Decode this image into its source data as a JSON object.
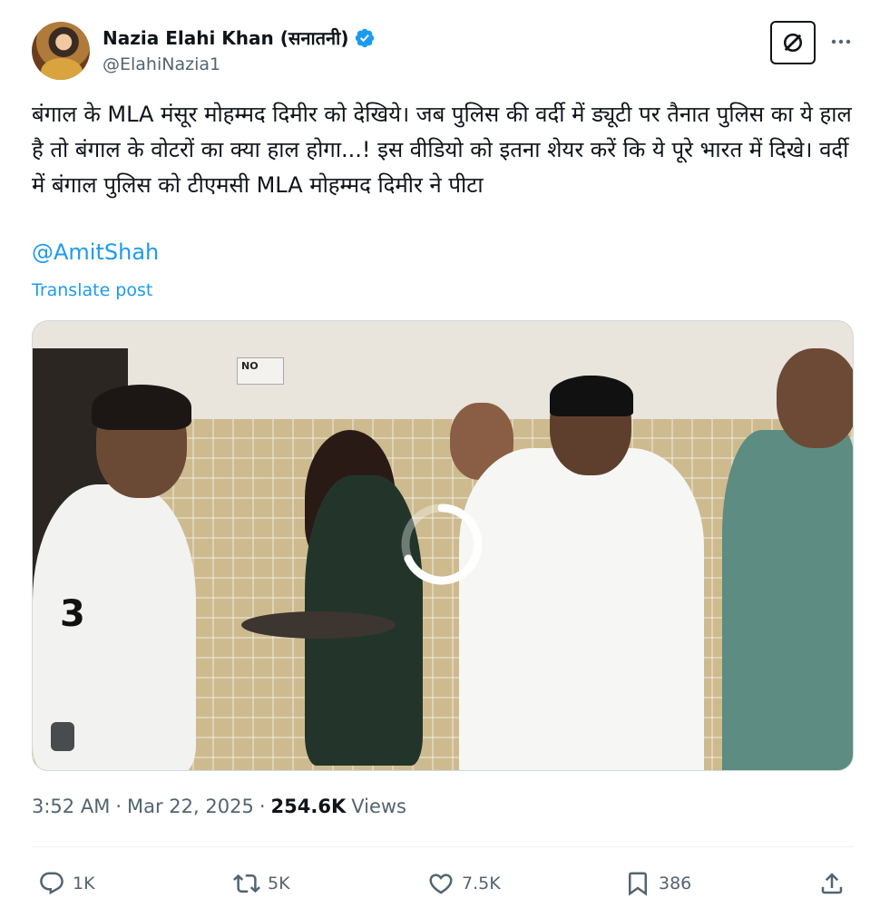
{
  "author": {
    "display_name": "Nazia Elahi Khan (सनातनी)",
    "handle": "@ElahiNazia1",
    "verified_color": "#1d9bf0"
  },
  "post": {
    "text": "बंगाल के MLA मंसूर मोहम्मद दिमीर को देखिये। जब पुलिस की वर्दी में ड्यूटी पर तैनात पुलिस का ये हाल है तो बंगाल के वोटरों का क्या हाल होगा...! इस वीडियो को इतना शेयर करें कि ये पूरे भारत में दिखे। वर्दी में बंगाल पुलिस को टीएमसी MLA मोहम्मद दिमीर ने पीटा",
    "mention": "@AmitShah",
    "translate_label": "Translate post",
    "media_sign_text": "NO",
    "jersey_number": "3"
  },
  "meta": {
    "time": "3:52 AM",
    "separator": "·",
    "date": "Mar 22, 2025",
    "views_count": "254.6K",
    "views_label": "Views"
  },
  "actions": {
    "replies": "1K",
    "reposts": "5K",
    "likes": "7.5K",
    "bookmarks": "386"
  },
  "icons": {
    "grok": "grok-icon",
    "more": "more-icon",
    "reply": "reply-icon",
    "repost": "repost-icon",
    "like": "heart-icon",
    "bookmark": "bookmark-icon",
    "share": "share-icon",
    "verified": "verified-badge-icon"
  },
  "colors": {
    "link": "#1d9bf0",
    "secondary_text": "#536471",
    "primary_text": "#0f1419"
  }
}
